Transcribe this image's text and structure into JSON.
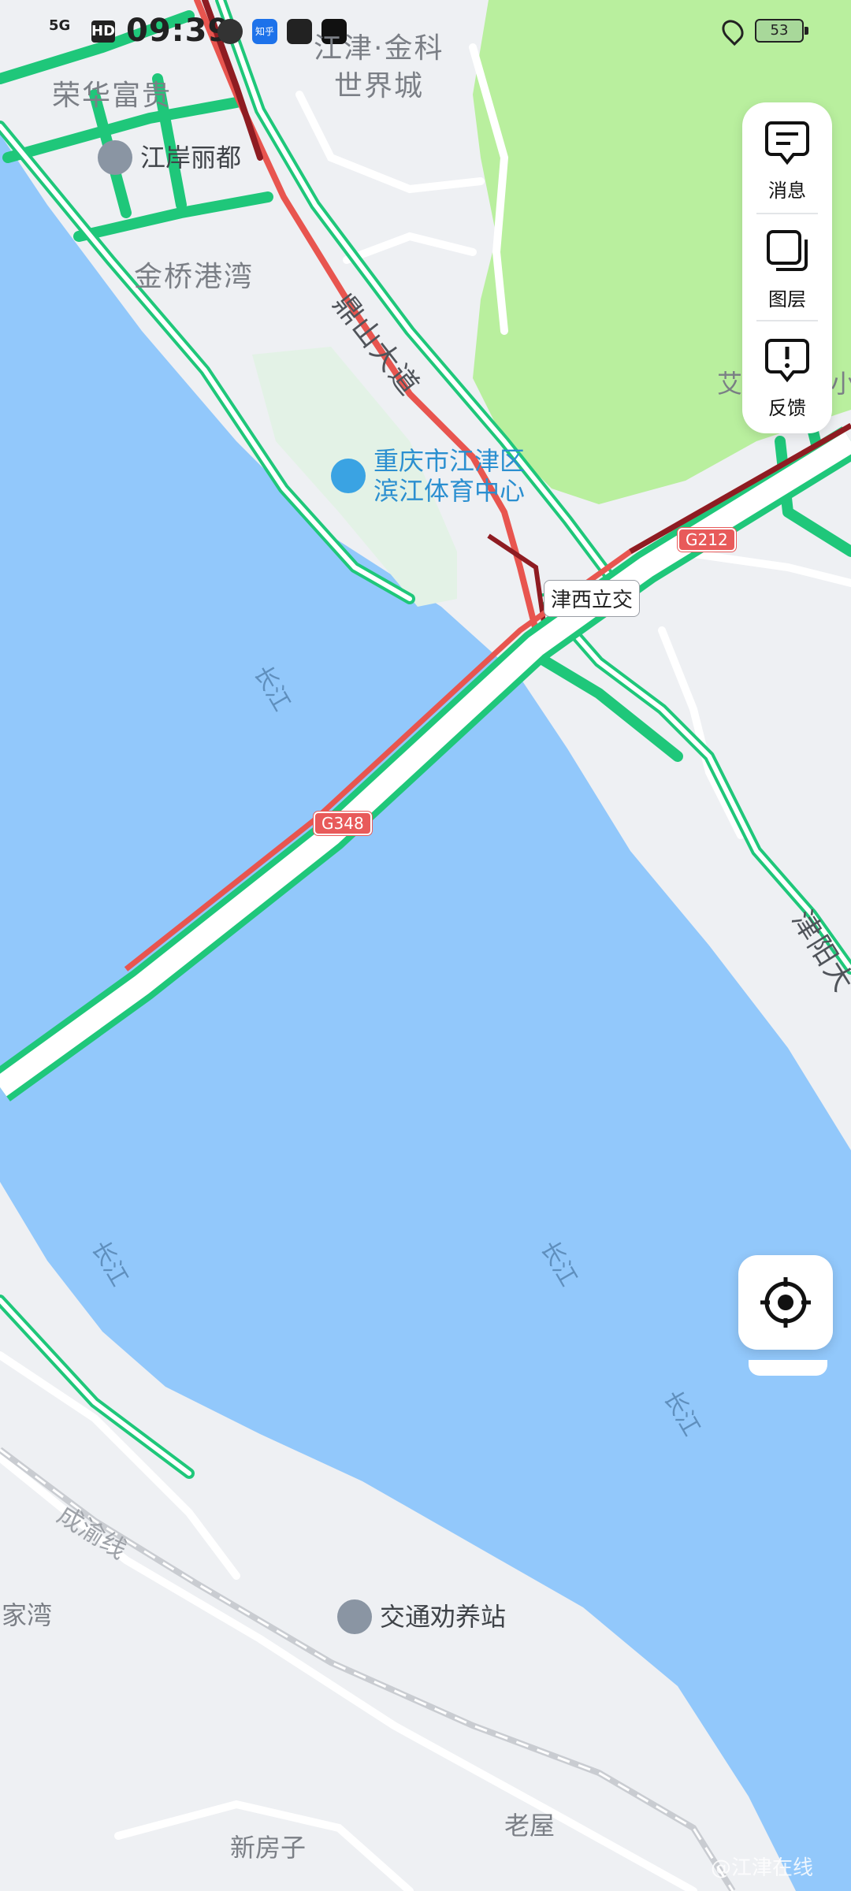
{
  "status_bar": {
    "signal": "5G",
    "hd": "HD",
    "time": "09:39",
    "app_icons": [
      "wechat-icon",
      "zhihu-icon",
      "telegram-icon",
      "tiktok-icon"
    ],
    "zhihu_label": "知乎",
    "battery": "53"
  },
  "map": {
    "areas": {
      "ronghua": "荣华富贵",
      "jinqiao": "金桥港湾",
      "jinke": "江津·金科",
      "jinke2": "世界城",
      "liujiawan": "刘家湾",
      "xinfangzi": "新房子",
      "laowu": "老屋",
      "ai": "艾",
      "xiao": "小"
    },
    "roads": {
      "dingshan": "鼎山大道",
      "jinyang": "津阳大",
      "chengyu": "成渝线"
    },
    "pois": {
      "jiangan": "江岸丽都",
      "sports_line1": "重庆市江津区",
      "sports_line2": "滨江体育中心",
      "station": "交通劝养站"
    },
    "highway_shields": [
      "G212",
      "G348"
    ],
    "junction": "津西立交",
    "river": "长江",
    "colors": {
      "water": "#92c8fb",
      "land": "#eef0f3",
      "park": "#b9ef9e",
      "traffic_smooth": "#1fc77a",
      "traffic_slow": "#e8554f",
      "traffic_jam": "#8e1c22"
    }
  },
  "side_panel": {
    "messages": "消息",
    "layers": "图层",
    "feedback": "反馈"
  },
  "watermark": "@江津在线"
}
